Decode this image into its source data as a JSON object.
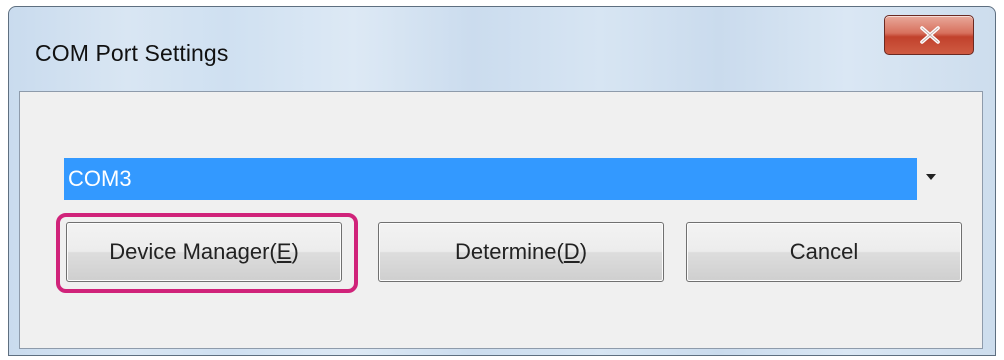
{
  "window": {
    "title": "COM Port Settings",
    "close_icon": "close-x-icon",
    "close_color": "#c1412c"
  },
  "combo": {
    "selected_value": "COM3",
    "selection_color": "#3399ff",
    "arrow_icon": "dropdown-arrow-icon"
  },
  "buttons": {
    "device_manager": {
      "label_prefix": "Device Manager(",
      "mnemonic": "E",
      "label_suffix": ")"
    },
    "determine": {
      "label_prefix": "Determine(",
      "mnemonic": "D",
      "label_suffix": ")"
    },
    "cancel": {
      "label": "Cancel"
    }
  },
  "highlight": {
    "target": "device-manager-button",
    "color": "#d0237a"
  }
}
